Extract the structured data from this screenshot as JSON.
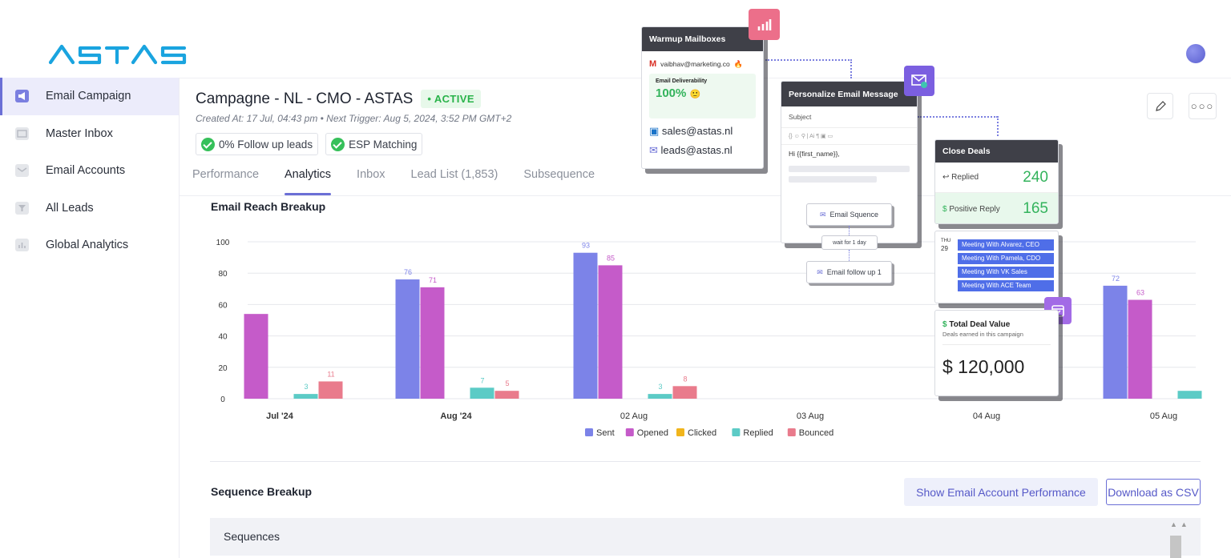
{
  "brand": {
    "logo_text": "ASTAS"
  },
  "sidebar": {
    "items": [
      {
        "label": "Email Campaign",
        "icon": "megaphone-icon",
        "active": true
      },
      {
        "label": "Master Inbox",
        "icon": "inbox-icon",
        "active": false
      },
      {
        "label": "Email Accounts",
        "icon": "envelope-icon",
        "active": false
      },
      {
        "label": "All Leads",
        "icon": "leads-icon",
        "active": false
      },
      {
        "label": "Global Analytics",
        "icon": "bar-chart-icon",
        "active": false
      }
    ]
  },
  "campaign": {
    "title": "Campagne - NL - CMO - ASTAS",
    "status": "• ACTIVE",
    "meta": "Created At: 17 Jul, 04:43 pm • Next Trigger: Aug 5, 2024, 3:52 PM GMT+2",
    "chips": [
      "0% Follow up leads",
      "ESP Matching"
    ]
  },
  "tabs": [
    "Performance",
    "Analytics",
    "Inbox",
    "Lead List (1,853)",
    "Subsequence"
  ],
  "selected_tab": "Analytics",
  "reach_section": {
    "title": "Email Reach Breakup"
  },
  "chart_data": {
    "type": "bar",
    "title": "Email Reach Breakup",
    "xlabel": "",
    "ylabel": "",
    "ylim": [
      0,
      100
    ],
    "y_ticks": [
      "0",
      "20",
      "40",
      "60",
      "80",
      "100"
    ],
    "x_tick_labels": [
      "Jul '24",
      "Aug '24",
      "02 Aug",
      "03 Aug",
      "04 Aug",
      "05 Aug"
    ],
    "groups": [
      "Jul '24",
      "Aug '24",
      "02 Aug",
      "05 Aug"
    ],
    "series": [
      {
        "name": "Sent",
        "color": "#7c83e8",
        "values": [
          0,
          76,
          93,
          72
        ]
      },
      {
        "name": "Opened",
        "color": "#c55bc9",
        "values": [
          54,
          71,
          85,
          63
        ]
      },
      {
        "name": "Clicked",
        "color": "#f1b51c",
        "values": [
          0,
          0,
          0,
          0
        ]
      },
      {
        "name": "Replied",
        "color": "#5ccbc6",
        "values": [
          3,
          7,
          3,
          5
        ]
      },
      {
        "name": "Bounced",
        "color": "#e97b8c",
        "values": [
          11,
          5,
          8,
          0
        ]
      }
    ],
    "data_labels": [
      {
        "series": "Replied",
        "group": "Jul '24",
        "text": "3"
      },
      {
        "series": "Bounced",
        "group": "Jul '24",
        "text": "11"
      },
      {
        "series": "Sent",
        "group": "Aug '24",
        "text": "76"
      },
      {
        "series": "Opened",
        "group": "Aug '24",
        "text": "71"
      },
      {
        "series": "Replied",
        "group": "Aug '24",
        "text": "7"
      },
      {
        "series": "Bounced",
        "group": "Aug '24",
        "text": "5"
      },
      {
        "series": "Sent",
        "group": "02 Aug",
        "text": "93"
      },
      {
        "series": "Opened",
        "group": "02 Aug",
        "text": "85"
      },
      {
        "series": "Replied",
        "group": "02 Aug",
        "text": "3"
      },
      {
        "series": "Bounced",
        "group": "02 Aug",
        "text": "8"
      },
      {
        "series": "Sent",
        "group": "05 Aug",
        "text": "72"
      },
      {
        "series": "Opened",
        "group": "05 Aug",
        "text": "63"
      }
    ],
    "grid": true,
    "legend": "bottom-center"
  },
  "sequence_section": {
    "title": "Sequence Breakup",
    "show_perf_label": "Show Email Account Performance",
    "download_label": "Download as CSV",
    "table_header": "Sequences"
  },
  "overlay": {
    "warmup": {
      "title": "Warmup Mailboxes",
      "account": "vaibhav@marketing.co",
      "deliverability_label": "Email Deliverability",
      "deliverability_value": "100%",
      "emails": [
        "sales@astas.nl",
        "leads@astas.nl"
      ]
    },
    "personalize": {
      "title": "Personalize Email Message",
      "subject_label": "Subject",
      "toolbar": "{} ☺ ⚲ | Ai ¶ ▣ ▭",
      "greeting": "Hi {{first_name}},",
      "sequence_btn": "Email Squence",
      "wait_label": "wait for 1 day",
      "followup_btn": "Email follow up 1"
    },
    "close_deals": {
      "title": "Close Deals",
      "replied_label": "Replied",
      "replied_value": "240",
      "positive_label": "Positive Reply",
      "positive_value": "165"
    },
    "calendar": {
      "day": "THU",
      "date": "29",
      "meetings": [
        "Meeting With Alvarez, CEO",
        "Meeting With Pamela, CDO",
        "Meeting With VK Sales",
        "Meeting With ACE Team"
      ]
    },
    "deal_value": {
      "title": "Total Deal Value",
      "subtitle": "Deals earned in this campaign",
      "amount": "$ 120,000"
    }
  }
}
